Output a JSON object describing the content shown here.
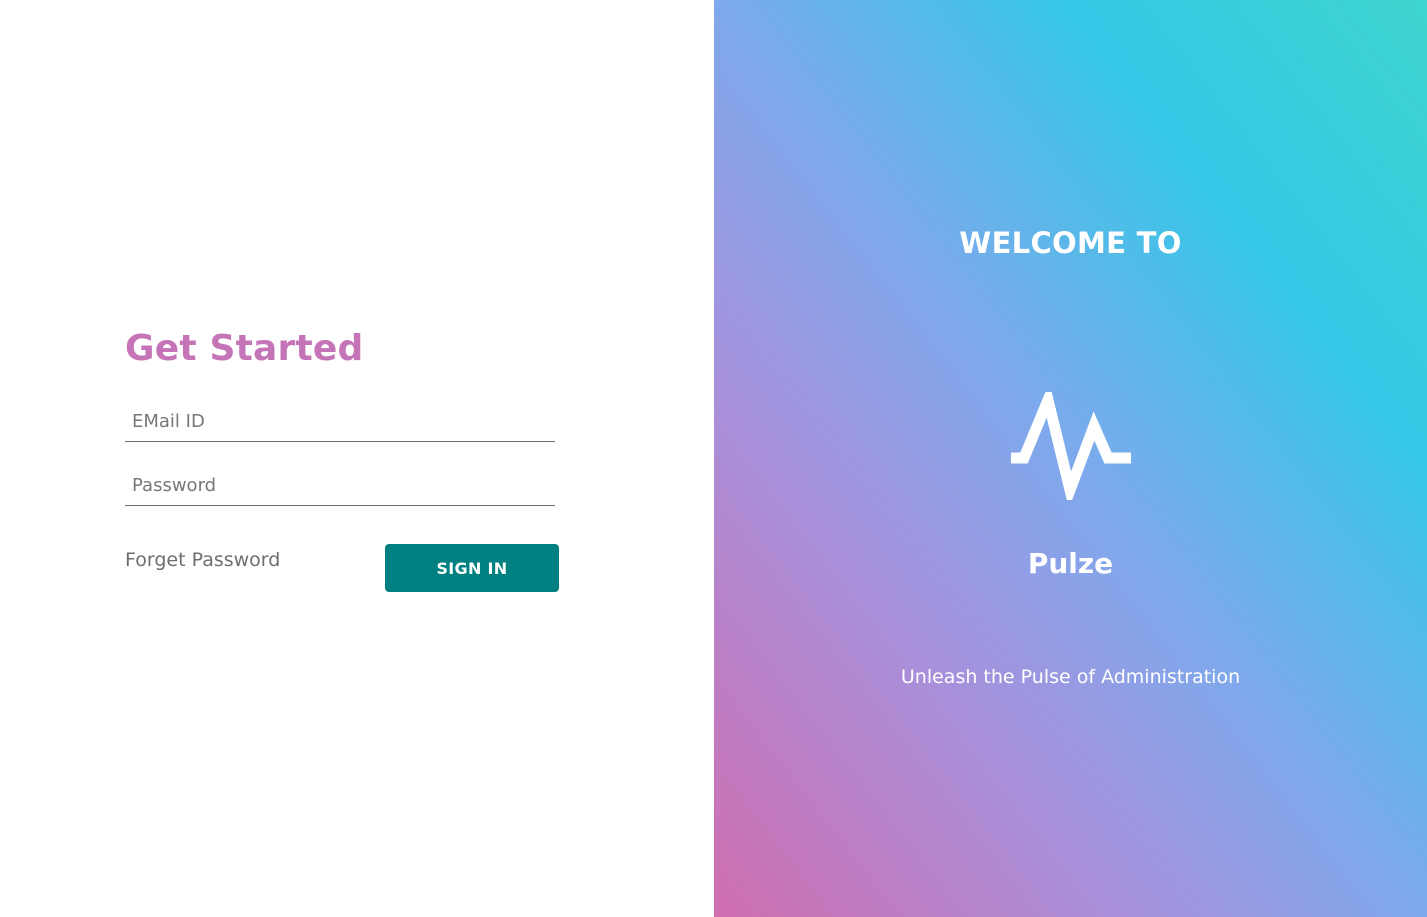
{
  "login": {
    "title": "Get Started",
    "email_placeholder": "EMail ID",
    "password_placeholder": "Password",
    "forgot_label": "Forget Password",
    "signin_label": "SIGN IN"
  },
  "branding": {
    "welcome": "WELCOME TO",
    "logo_icon": "pulse-line-icon",
    "name": "Pulze",
    "tagline": "Unleash the Pulse of Administration"
  },
  "colors": {
    "title": "#c674b8",
    "button": "#008080",
    "gradient": [
      "#d06eb0",
      "#a691dc",
      "#7ea9ec",
      "#33c8e6",
      "#3fd6cf"
    ]
  }
}
